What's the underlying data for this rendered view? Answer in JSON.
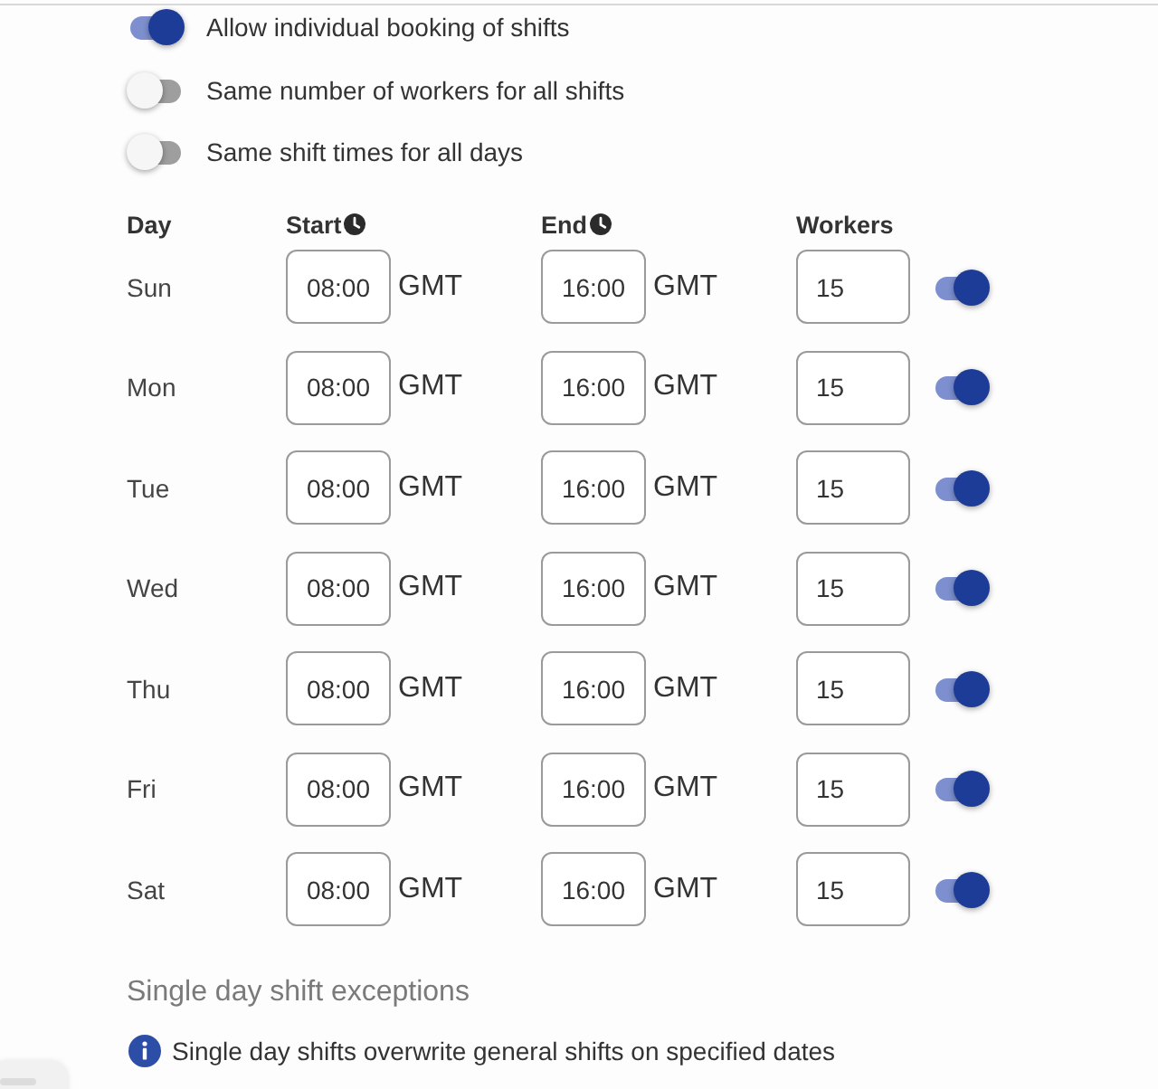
{
  "toggles": [
    {
      "label": "Allow individual booking of shifts",
      "on": true
    },
    {
      "label": "Same number of workers for all shifts",
      "on": false
    },
    {
      "label": "Same shift times for all days",
      "on": false
    }
  ],
  "schedule": {
    "columns": [
      {
        "label": "Day",
        "kind": "text"
      },
      {
        "label": "Start",
        "kind": "time"
      },
      {
        "label": "End",
        "kind": "time"
      },
      {
        "label": "Workers",
        "kind": "text"
      }
    ],
    "rows": [
      {
        "day": "Sun",
        "start": "08:00",
        "start_zone": "GMT",
        "end": "16:00",
        "end_zone": "GMT",
        "workers": "15",
        "on": true
      },
      {
        "day": "Mon",
        "start": "08:00",
        "start_zone": "GMT",
        "end": "16:00",
        "end_zone": "GMT",
        "workers": "15",
        "on": true
      },
      {
        "day": "Tue",
        "start": "08:00",
        "start_zone": "GMT",
        "end": "16:00",
        "end_zone": "GMT",
        "workers": "15",
        "on": true
      },
      {
        "day": "Wed",
        "start": "08:00",
        "start_zone": "GMT",
        "end": "16:00",
        "end_zone": "GMT",
        "workers": "15",
        "on": true
      },
      {
        "day": "Thu",
        "start": "08:00",
        "start_zone": "GMT",
        "end": "16:00",
        "end_zone": "GMT",
        "workers": "15",
        "on": true
      },
      {
        "day": "Fri",
        "start": "08:00",
        "start_zone": "GMT",
        "end": "16:00",
        "end_zone": "GMT",
        "workers": "15",
        "on": true
      },
      {
        "day": "Sat",
        "start": "08:00",
        "start_zone": "GMT",
        "end": "16:00",
        "end_zone": "GMT",
        "workers": "15",
        "on": true
      }
    ]
  },
  "exceptions": {
    "heading": "Single day shift exceptions",
    "info": "Single day shifts overwrite general shifts on specified dates"
  }
}
